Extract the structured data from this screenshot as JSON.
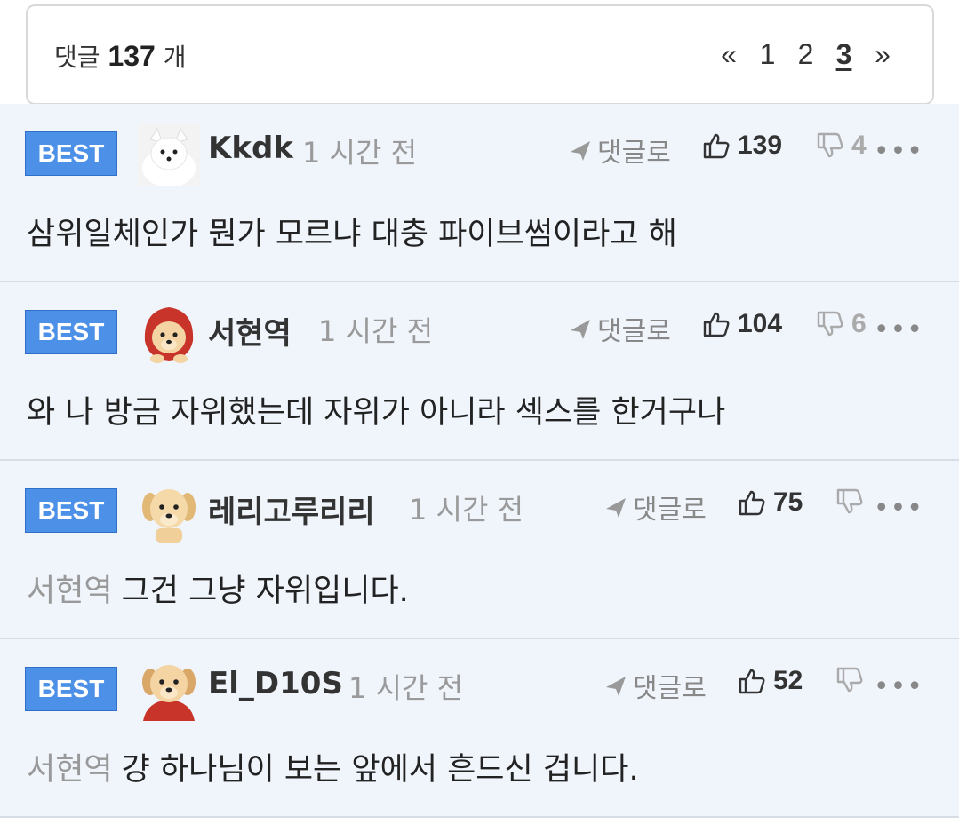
{
  "header": {
    "count_prefix": "댓글",
    "count": "137",
    "count_suffix": "개",
    "pagination": {
      "prev": "«",
      "pages": [
        "1",
        "2",
        "3"
      ],
      "current": "3",
      "next": "»"
    }
  },
  "comments": [
    {
      "badge": "BEST",
      "avatar_icon": "white-fox-avatar",
      "author": "Kkdk",
      "time": "1 시간 전",
      "reply_label": "댓글로",
      "likes": "139",
      "dislikes": "4",
      "mention": "",
      "text": "삼위일체인가 뭔가 모르냐 대충 파이브썸이라고 해"
    },
    {
      "badge": "BEST",
      "avatar_icon": "puppy-red-hood-avatar",
      "author": "서현역",
      "time": "1 시간 전",
      "reply_label": "댓글로",
      "likes": "104",
      "dislikes": "6",
      "mention": "",
      "text": "와 나 방금 자위했는데 자위가 아니라 섹스를 한거구나"
    },
    {
      "badge": "BEST",
      "avatar_icon": "puppy-avatar",
      "author": "레리고루리리",
      "time": "1 시간 전",
      "reply_label": "댓글로",
      "likes": "75",
      "dislikes": "",
      "mention": "서현역",
      "text": "그건 그냥 자위입니다."
    },
    {
      "badge": "BEST",
      "avatar_icon": "puppy-red-cape-avatar",
      "author": "El_D10S",
      "time": "1 시간 전",
      "reply_label": "댓글로",
      "likes": "52",
      "dislikes": "",
      "mention": "서현역",
      "text": "걍 하나님이 보는 앞에서 흔드신 겁니다."
    }
  ],
  "colors": {
    "badge": "#4d90e8",
    "row_bg": "#f0f5fc",
    "muted": "#9a9a9a"
  }
}
